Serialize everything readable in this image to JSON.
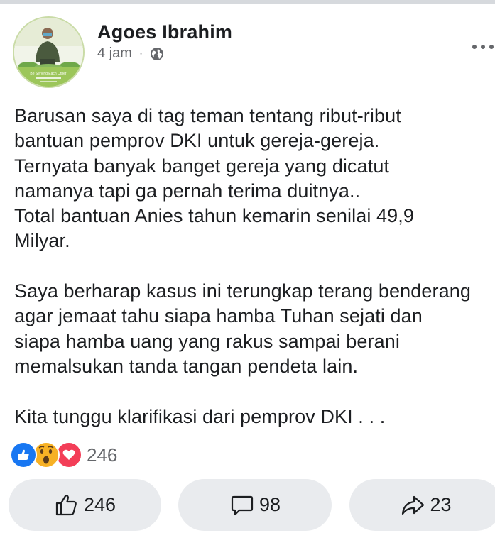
{
  "post": {
    "author": "Agoes Ibrahim",
    "time": "4 jam",
    "separator": "·",
    "audience_icon": "globe-icon",
    "more_icon": "more-dots-icon",
    "avatar_caption": "Be Serving Each Other",
    "lines": [
      "Barusan saya di tag teman tentang ribut-ribut",
      "bantuan pemprov DKI untuk gereja-gereja.",
      "Ternyata banyak banget gereja yang dicatut",
      "namanya tapi ga pernah terima duitnya..",
      "Total bantuan Anies tahun kemarin senilai 49,9",
      "Milyar.",
      "",
      "Saya berharap kasus ini terungkap terang benderang",
      "agar jemaat tahu siapa hamba Tuhan sejati dan",
      "siapa hamba uang yang rakus sampai berani",
      "memalsukan tanda tangan pendeta lain.",
      "",
      "Kita tunggu klarifikasi dari pemprov DKI . . ."
    ]
  },
  "reactions": {
    "icons": [
      "like-reaction-icon",
      "wow-reaction-icon",
      "love-reaction-icon"
    ],
    "count": "246"
  },
  "actions": {
    "like_count": "246",
    "comment_count": "98",
    "share_count": "23"
  },
  "colors": {
    "like_blue": "#1877f2",
    "love_red": "#f33e58",
    "wow_yellow": "#f7b125",
    "secondary_text": "#65676b",
    "button_bg": "#e9ebee"
  }
}
